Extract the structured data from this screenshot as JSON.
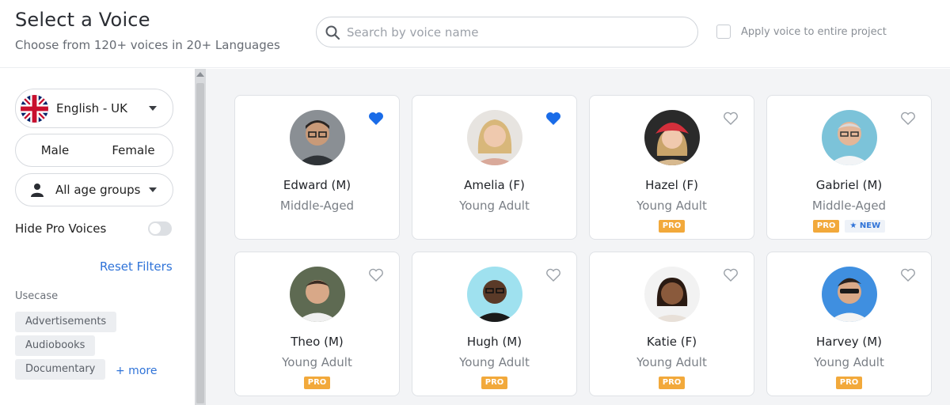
{
  "header": {
    "title": "Select a Voice",
    "subtitle": "Choose from 120+ voices in 20+ Languages",
    "search_placeholder": "Search by voice name",
    "apply_label": "Apply voice to entire project"
  },
  "sidebar": {
    "language": "English - UK",
    "gender_male": "Male",
    "gender_female": "Female",
    "age_group": "All age groups",
    "hide_pro_label": "Hide Pro Voices",
    "reset_label": "Reset Filters",
    "usecase_label": "Usecase",
    "usecases": [
      "Advertisements",
      "Audiobooks",
      "Documentary"
    ],
    "more_label": "+ more"
  },
  "voices": [
    {
      "name": "Edward (M)",
      "age": "Middle-Aged",
      "favorite": true,
      "pro": false,
      "new": false
    },
    {
      "name": "Amelia (F)",
      "age": "Young Adult",
      "favorite": true,
      "pro": false,
      "new": false
    },
    {
      "name": "Hazel (F)",
      "age": "Young Adult",
      "favorite": false,
      "pro": true,
      "new": false
    },
    {
      "name": "Gabriel (M)",
      "age": "Middle-Aged",
      "favorite": false,
      "pro": true,
      "new": true
    },
    {
      "name": "Theo (M)",
      "age": "Young Adult",
      "favorite": false,
      "pro": true,
      "new": false
    },
    {
      "name": "Hugh (M)",
      "age": "Young Adult",
      "favorite": false,
      "pro": true,
      "new": false
    },
    {
      "name": "Katie (F)",
      "age": "Young Adult",
      "favorite": false,
      "pro": true,
      "new": false
    },
    {
      "name": "Harvey (M)",
      "age": "Young Adult",
      "favorite": false,
      "pro": true,
      "new": false
    }
  ],
  "badges": {
    "pro": "PRO",
    "new": "★ NEW"
  },
  "colors": {
    "accent": "#2f73d8",
    "favorite": "#1a6ce8",
    "pro": "#f2a93b"
  }
}
